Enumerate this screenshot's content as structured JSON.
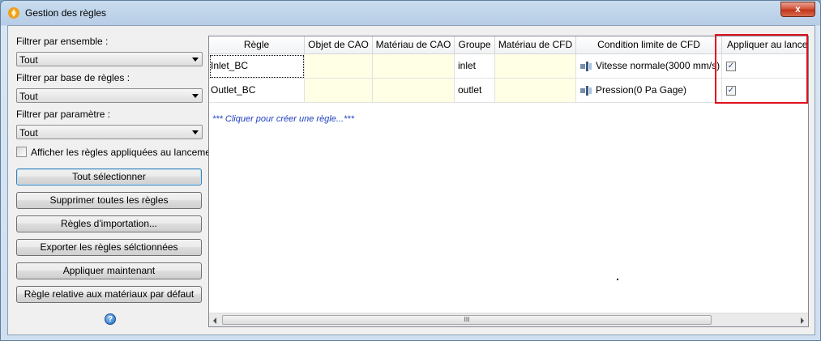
{
  "window": {
    "title": "Gestion des règles",
    "close_label": "x"
  },
  "filters": {
    "ensemble_label": "Filtrer par ensemble :",
    "ensemble_value": "Tout",
    "base_label": "Filtrer par base de règles :",
    "base_value": "Tout",
    "param_label": "Filtrer par paramètre :",
    "param_value": "Tout",
    "show_applied_label": "Afficher les règles appliquées au lancement"
  },
  "buttons": {
    "select_all": "Tout sélectionner",
    "delete_all": "Supprimer toutes les règles",
    "import": "Règles d'importation...",
    "export": "Exporter les règles sélctionnées",
    "apply_now": "Appliquer maintenant",
    "default_material": "Règle relative aux matériaux par défaut"
  },
  "grid": {
    "columns": [
      "Règle",
      "Objet de CAO",
      "Matériau de CAO",
      "Groupe",
      "Matériau de CFD",
      "Condition limite de CFD",
      "Appliquer au lancement"
    ],
    "rows": [
      {
        "regle": "Inlet_BC",
        "objet": "",
        "materiau_cao": "",
        "groupe": "inlet",
        "materiau_cfd": "",
        "condition": "Vitesse normale(3000 mm/s)",
        "appliquer": true
      },
      {
        "regle": "Outlet_BC",
        "objet": "",
        "materiau_cao": "",
        "groupe": "outlet",
        "materiau_cfd": "",
        "condition": "Pression(0 Pa Gage)",
        "appliquer": true
      }
    ],
    "create_link": "*** Cliquer pour créer une règle...***",
    "scroll_grip": "III"
  },
  "icons": {
    "app": "app-logo-icon",
    "help": "help-icon",
    "boundary": "boundary-condition-icon"
  },
  "colors": {
    "highlight": "#e0121f",
    "link": "#1f3fbf",
    "editable_cell": "#ffffe6"
  }
}
